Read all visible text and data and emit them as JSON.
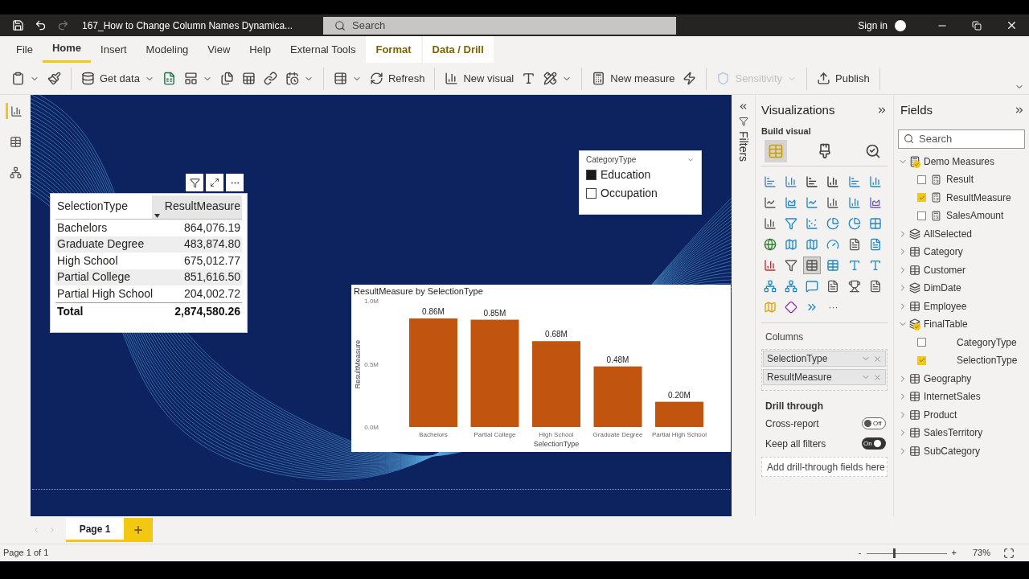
{
  "window": {
    "title": "167_How to Change Column Names Dynamica...",
    "search_placeholder": "Search",
    "sign_in": "Sign in"
  },
  "tabs": [
    {
      "label": "File",
      "selected": false,
      "kind": "plain"
    },
    {
      "label": "Home",
      "selected": true,
      "kind": "plain"
    },
    {
      "label": "Insert",
      "selected": false,
      "kind": "plain"
    },
    {
      "label": "Modeling",
      "selected": false,
      "kind": "plain"
    },
    {
      "label": "View",
      "selected": false,
      "kind": "plain"
    },
    {
      "label": "Help",
      "selected": false,
      "kind": "plain"
    },
    {
      "label": "External Tools",
      "selected": false,
      "kind": "plain"
    },
    {
      "label": "Format",
      "selected": false,
      "kind": "contextual"
    },
    {
      "label": "Data / Drill",
      "selected": false,
      "kind": "contextual"
    }
  ],
  "ribbon": [
    [
      {
        "caret": true,
        "disabled": false
      },
      {
        "caret": false,
        "disabled": false
      }
    ],
    [
      {
        "label": "Get data",
        "caret": true,
        "disabled": false
      },
      {
        "caret": false,
        "disabled": false
      },
      {
        "caret": true,
        "disabled": false
      },
      {
        "caret": false,
        "disabled": false
      },
      {
        "caret": false,
        "disabled": false
      },
      {
        "caret": false,
        "disabled": false
      },
      {
        "caret": true,
        "disabled": false
      }
    ],
    [
      {
        "caret": true,
        "disabled": false
      },
      {
        "label": "Refresh",
        "caret": false,
        "disabled": false
      }
    ],
    [
      {
        "label": "New visual",
        "caret": false,
        "disabled": false
      },
      {
        "caret": false,
        "disabled": false
      },
      {
        "caret": true,
        "disabled": false
      }
    ],
    [
      {
        "label": "New measure",
        "caret": false,
        "disabled": false
      },
      {
        "caret": false,
        "disabled": false
      }
    ],
    [
      {
        "label": "Sensitivity",
        "caret": true,
        "disabled": true
      }
    ],
    [
      {
        "label": "Publish",
        "caret": false,
        "disabled": false
      }
    ]
  ],
  "views": [
    {
      "selected": true
    },
    {
      "selected": false
    },
    {
      "selected": false
    }
  ],
  "table_visual": {
    "columns": [
      {
        "label": "SelectionType",
        "sorted": false
      },
      {
        "label": "ResultMeasure",
        "sorted": true
      }
    ],
    "rows": [
      [
        "Bachelors",
        "864,076.19"
      ],
      [
        "Graduate Degree",
        "483,874.80"
      ],
      [
        "High School",
        "675,012.77"
      ],
      [
        "Partial College",
        "851,616.50"
      ],
      [
        "Partial High School",
        "204,002.72"
      ]
    ],
    "total": [
      "Total",
      "2,874,580.26"
    ]
  },
  "slicer": {
    "title": "CategoryType",
    "items": [
      {
        "label": "Education",
        "checked": true
      },
      {
        "label": "Occupation",
        "checked": false
      }
    ]
  },
  "bar_chart": {
    "chart_data": {
      "type": "bar",
      "title": "ResultMeasure by SelectionType",
      "xlabel": "SelectionType",
      "ylabel": "ResultMeasure",
      "categories": [
        "Bachelors",
        "Partial College",
        "High School",
        "Graduate Degree",
        "Partial High School"
      ],
      "values": [
        860000,
        850000,
        680000,
        480000,
        200000
      ],
      "ylim": [
        0,
        1000000
      ],
      "yticks": [
        {
          "value": 0,
          "label": "0.0M"
        },
        {
          "value": 500000,
          "label": "0.5M"
        },
        {
          "value": 1000000,
          "label": "1.0M"
        }
      ],
      "value_labels": [
        "0.86M",
        "0.85M",
        "0.68M",
        "0.48M",
        "0.20M"
      ]
    }
  },
  "filters": {
    "label": "Filters"
  },
  "visualizations": {
    "title": "Visualizations",
    "subtitle": "Build visual",
    "build_tabs": [
      {
        "selected": true
      },
      {
        "selected": false
      },
      {
        "selected": false
      }
    ],
    "gallery": [
      {
        "selected": false
      },
      {
        "selected": false
      },
      {
        "selected": false
      },
      {
        "selected": false
      },
      {
        "selected": false
      },
      {
        "selected": false
      },
      {
        "selected": false
      },
      {
        "selected": false
      },
      {
        "selected": false
      },
      {
        "selected": false
      },
      {
        "selected": false
      },
      {
        "selected": false
      },
      {
        "selected": false
      },
      {
        "selected": false
      },
      {
        "selected": false
      },
      {
        "selected": false
      },
      {
        "selected": false
      },
      {
        "selected": false
      },
      {
        "selected": false
      },
      {
        "selected": false
      },
      {
        "selected": false
      },
      {
        "selected": false
      },
      {
        "selected": false
      },
      {
        "selected": false
      },
      {
        "selected": false
      },
      {
        "selected": false
      },
      {
        "selected": true
      },
      {
        "selected": false
      },
      {
        "selected": false
      },
      {
        "selected": false
      },
      {
        "selected": false
      },
      {
        "selected": false
      },
      {
        "selected": false
      },
      {
        "selected": false
      },
      {
        "selected": false
      },
      {
        "selected": false
      },
      {
        "selected": false
      },
      {
        "selected": false
      },
      {
        "selected": false
      }
    ],
    "more": "···",
    "columns_label": "Columns",
    "wells": [
      "SelectionType",
      "ResultMeasure"
    ],
    "drill_label": "Drill through",
    "toggles": [
      {
        "label": "Cross-report",
        "on": false,
        "state_text": "Off"
      },
      {
        "label": "Keep all filters",
        "on": true,
        "state_text": "On"
      }
    ],
    "drop_hint": "Add drill-through fields here"
  },
  "fields": {
    "title": "Fields",
    "search_placeholder": "Search",
    "tree": [
      {
        "label": "Demo Measures",
        "kind": "measures",
        "expanded": true,
        "in_use": true,
        "children": [
          {
            "label": "Result",
            "kind": "measure",
            "checked": false
          },
          {
            "label": "ResultMeasure",
            "kind": "measure",
            "checked": true
          },
          {
            "label": "SalesAmount",
            "kind": "measure",
            "checked": false
          }
        ]
      },
      {
        "label": "AllSelected",
        "kind": "calculated",
        "expanded": false,
        "in_use": false
      },
      {
        "label": "Category",
        "kind": "table",
        "expanded": false,
        "in_use": false
      },
      {
        "label": "Customer",
        "kind": "table",
        "expanded": false,
        "in_use": false
      },
      {
        "label": "DimDate",
        "kind": "calculated",
        "expanded": false,
        "in_use": false
      },
      {
        "label": "Employee",
        "kind": "table",
        "expanded": false,
        "in_use": false
      },
      {
        "label": "FinalTable",
        "kind": "calculated",
        "expanded": true,
        "in_use": true,
        "children": [
          {
            "label": "CategoryType",
            "kind": "column",
            "checked": false
          },
          {
            "label": "SelectionType",
            "kind": "column",
            "checked": true
          }
        ]
      },
      {
        "label": "Geography",
        "kind": "table",
        "expanded": false,
        "in_use": false
      },
      {
        "label": "InternetSales",
        "kind": "table",
        "expanded": false,
        "in_use": false
      },
      {
        "label": "Product",
        "kind": "table",
        "expanded": false,
        "in_use": false
      },
      {
        "label": "SalesTerritory",
        "kind": "table",
        "expanded": false,
        "in_use": false
      },
      {
        "label": "SubCategory",
        "kind": "table",
        "expanded": false,
        "in_use": false
      }
    ]
  },
  "pages": [
    {
      "label": "Page 1",
      "selected": true
    }
  ],
  "status": {
    "page_text": "Page 1 of 1",
    "zoom_minus": "-",
    "zoom_plus": "+",
    "zoom": {
      "level": 0.35
    },
    "zoom_text": "73%"
  }
}
